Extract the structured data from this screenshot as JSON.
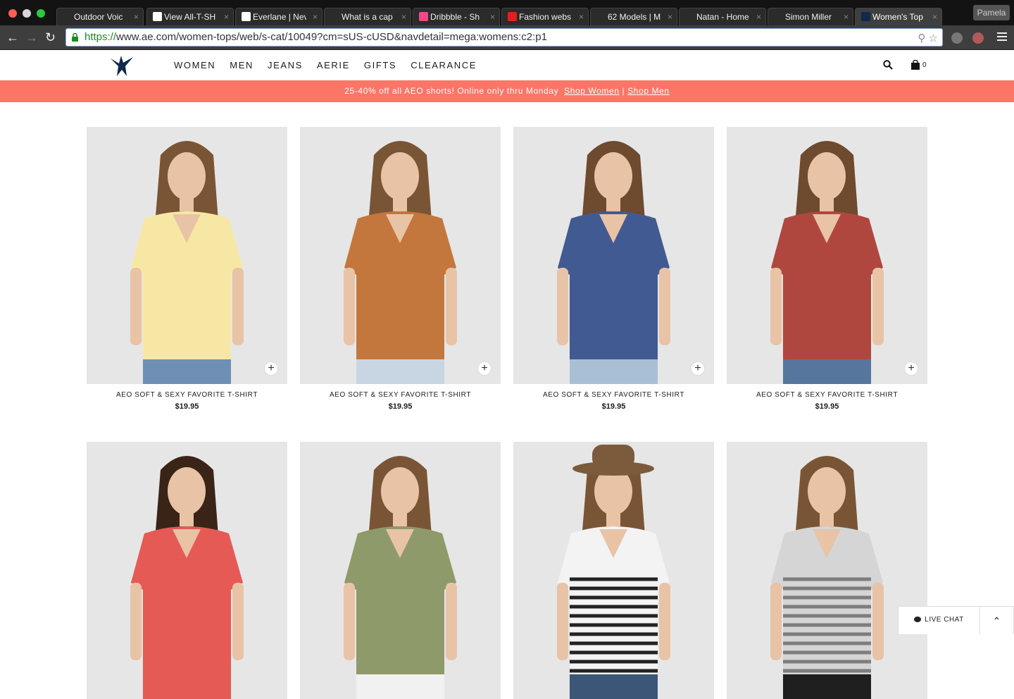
{
  "browser": {
    "tabs": [
      {
        "title": "Outdoor Voic",
        "favicon_color": "#2b2b2b"
      },
      {
        "title": "View All-T-SH",
        "favicon_color": "#ffffff"
      },
      {
        "title": "Everlane | Nev",
        "favicon_color": "#ffffff"
      },
      {
        "title": "What is a cap",
        "favicon_color": "#2b2b2b"
      },
      {
        "title": "Dribbble - Sh",
        "favicon_color": "#ea4c89"
      },
      {
        "title": "Fashion webs",
        "favicon_color": "#e02020"
      },
      {
        "title": "62 Models | M",
        "favicon_color": "#2b2b2b"
      },
      {
        "title": "Natan - Home",
        "favicon_color": "#2b2b2b"
      },
      {
        "title": "Simon Miller",
        "favicon_color": "#2b2b2b"
      },
      {
        "title": "Women's Top",
        "favicon_color": "#13294b",
        "active": true
      }
    ],
    "profile_label": "Pamela",
    "url_scheme": "https://",
    "url_rest": "www.ae.com/women-tops/web/s-cat/10049?cm=sUS-cUSD&navdetail=mega:womens:c2:p1"
  },
  "site": {
    "nav": [
      "WOMEN",
      "MEN",
      "JEANS",
      "AERIE",
      "GIFTS",
      "CLEARANCE"
    ],
    "bag_count": "0",
    "promo": {
      "text": "25-40% off all AEO shorts! Online only thru Monday",
      "link_women": "Shop Women",
      "separator": "|",
      "link_men": "Shop Men"
    }
  },
  "products": [
    {
      "name": "AEO SOFT & SEXY FAVORITE T-SHIRT",
      "price": "$19.95",
      "shirt_color": "#f6e8a4",
      "bottom_color": "#6f8fb5",
      "hair_color": "#7a5535"
    },
    {
      "name": "AEO SOFT & SEXY FAVORITE T-SHIRT",
      "price": "$19.95",
      "shirt_color": "#c4773c",
      "bottom_color": "#c8d6e3",
      "hair_color": "#7a5535"
    },
    {
      "name": "AEO SOFT & SEXY FAVORITE T-SHIRT",
      "price": "$19.95",
      "shirt_color": "#425a92",
      "bottom_color": "#a9bfd5",
      "hair_color": "#6e4a2f"
    },
    {
      "name": "AEO SOFT & SEXY FAVORITE T-SHIRT",
      "price": "$19.95",
      "shirt_color": "#b0473e",
      "bottom_color": "#56769d",
      "hair_color": "#6e4a2f"
    },
    {
      "name": "",
      "price": "",
      "shirt_color": "#e55a55",
      "bottom_color": "#e55a55",
      "hair_color": "#3a2418"
    },
    {
      "name": "",
      "price": "",
      "shirt_color": "#8f9a6a",
      "bottom_color": "#f1f1f1",
      "hair_color": "#7a5535"
    },
    {
      "name": "",
      "price": "",
      "shirt_color": "#f3f3f3",
      "bottom_color": "#3c5678",
      "hair_color": "#7a5535",
      "stripes": "#222222",
      "hat_color": "#7b5b3c"
    },
    {
      "name": "",
      "price": "",
      "shirt_color": "#d5d5d5",
      "bottom_color": "#1f1f1f",
      "hair_color": "#7a5535",
      "stripes": "#7d7d7d"
    }
  ],
  "live_chat": {
    "label": "LIVE CHAT"
  },
  "colors": {
    "promo_bg": "#fb7667",
    "brand_navy": "#13294b"
  }
}
